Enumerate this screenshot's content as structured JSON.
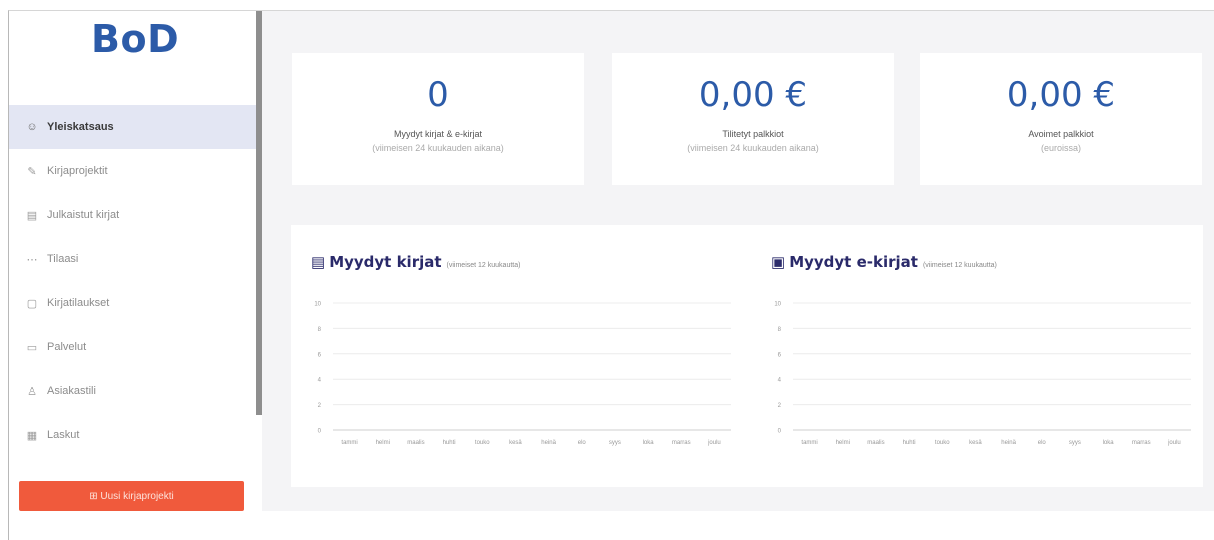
{
  "logo": "BoD",
  "sidebar": {
    "items": [
      {
        "icon": "☺",
        "icon_name": "dashboard-icon",
        "label": "Yleiskatsaus",
        "active": true
      },
      {
        "icon": "✎",
        "icon_name": "edit-icon",
        "label": "Kirjaprojektit"
      },
      {
        "icon": "▤",
        "icon_name": "book-icon",
        "label": "Julkaistut kirjat"
      },
      {
        "icon": "⋯",
        "icon_name": "orders-icon",
        "label": "Tilaasi"
      },
      {
        "icon": "▢",
        "icon_name": "book-order-icon",
        "label": "Kirjatilaukset"
      },
      {
        "icon": "▭",
        "icon_name": "services-icon",
        "label": "Palvelut"
      },
      {
        "icon": "♙",
        "icon_name": "user-icon",
        "label": "Asiakastili"
      },
      {
        "icon": "▦",
        "icon_name": "invoice-icon",
        "label": "Laskut"
      }
    ],
    "new_project": "⊞ Uusi kirjaprojekti"
  },
  "stats": [
    {
      "value": "0",
      "label": "Myydyt kirjat & e-kirjat",
      "sub": "(viimeisen 24 kuukauden aikana)"
    },
    {
      "value": "0,00 €",
      "label": "Tilitetyt palkkiot",
      "sub": "(viimeisen 24 kuukauden aikana)"
    },
    {
      "value": "0,00 €",
      "label": "Avoimet palkkiot",
      "sub": "(euroissa)"
    }
  ],
  "charts_text": [
    {
      "icon": "▤",
      "title": "Myydyt kirjat",
      "period": "(viimeiset 12 kuukautta)"
    },
    {
      "icon": "▣",
      "title": "Myydyt e-kirjat",
      "period": "(viimeiset 12 kuukautta)"
    }
  ],
  "accent": "#2c5ba8",
  "button_color": "#f05a3c",
  "chart_data": [
    {
      "type": "line",
      "title": "Myydyt kirjat",
      "categories": [
        "tammi",
        "helmi",
        "maalis",
        "huhti",
        "touko",
        "kesä",
        "heinä",
        "elo",
        "syys",
        "loka",
        "marras",
        "joulu"
      ],
      "series": [
        {
          "values": [
            0,
            0,
            0,
            0,
            0,
            0,
            0,
            0,
            0,
            0,
            0,
            0
          ]
        }
      ],
      "yticks": [
        0,
        2,
        4,
        6,
        8,
        10
      ],
      "ylim": [
        0,
        10
      ],
      "grid": true
    },
    {
      "type": "line",
      "title": "Myydyt e-kirjat",
      "categories": [
        "tammi",
        "helmi",
        "maalis",
        "huhti",
        "touko",
        "kesä",
        "heinä",
        "elo",
        "syys",
        "loka",
        "marras",
        "joulu"
      ],
      "series": [
        {
          "values": [
            0,
            0,
            0,
            0,
            0,
            0,
            0,
            0,
            0,
            0,
            0,
            0
          ]
        }
      ],
      "yticks": [
        0,
        2,
        4,
        6,
        8,
        10
      ],
      "ylim": [
        0,
        10
      ],
      "grid": true
    }
  ]
}
